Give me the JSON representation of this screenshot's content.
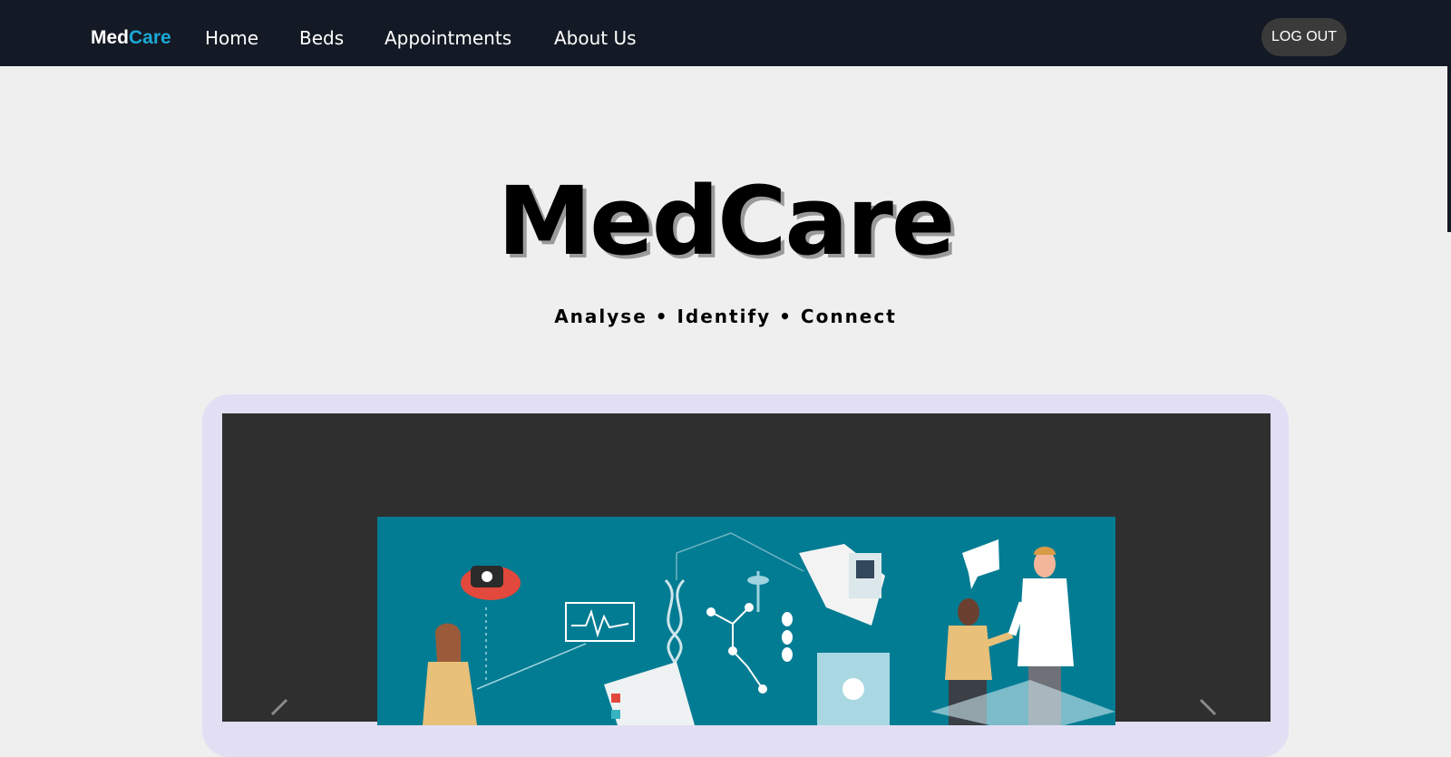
{
  "navbar": {
    "brand": {
      "part1": "Med",
      "part2": "Care"
    },
    "links": [
      {
        "label": "Home"
      },
      {
        "label": "Beds"
      },
      {
        "label": "Appointments"
      },
      {
        "label": "About Us"
      }
    ],
    "logout_label": "LOG OUT"
  },
  "hero": {
    "title": "MedCare",
    "tagline": "Analyse • Identify • Connect"
  },
  "carousel": {
    "prev_icon": "chevron-left-icon",
    "next_icon": "chevron-right-icon"
  },
  "colors": {
    "nav_bg": "#141a25",
    "brand_accent": "#1ba9d6",
    "page_bg": "#efefef",
    "frame": "#e2def4",
    "slide_bg": "#027c93"
  }
}
